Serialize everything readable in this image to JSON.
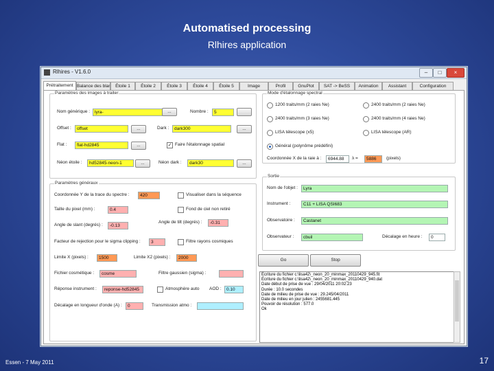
{
  "slide": {
    "title": "Automatised processing",
    "subtitle": "Rlhires application",
    "footer_left": "Essen - 7 May 2011",
    "page_number": "17"
  },
  "window": {
    "title": "Rlhires - V1.6.0",
    "min_label": "–",
    "max_label": "□",
    "close_label": "×"
  },
  "tabs": [
    "Prétraitement",
    "Balance des blancs",
    "Étoile 1",
    "Étoile 2",
    "Étoile 3",
    "Étoile 4",
    "Étoile 5",
    "Image",
    "Profil",
    "GnuPlot",
    "SAT -> BeSS",
    "Animation",
    "Assistant",
    "Configuration"
  ],
  "images": {
    "legend": "Paramètres des images à traiter",
    "generic_name_label": "Nom générique :",
    "generic_name_value": "lyra-",
    "number_label": "Nombre :",
    "number_value": "5",
    "offset_label": "Offset :",
    "offset_value": "offset",
    "dark_label": "Dark :",
    "dark_value": "dark300",
    "flat_label": "Flat :",
    "flat_value": "flat-hd2845",
    "spatial_flat_label": "Faire l'étalonnage spatial",
    "neon_star_label": "Néon étoile :",
    "neon_star_value": "hd52845-neon-1",
    "neon_dark_label": "Néon dark :",
    "neon_dark_value": "dark30",
    "browse_label": "..."
  },
  "general": {
    "legend": "Paramètres généraux",
    "y_coord_label": "Coordonnée Y de la trace du spectre :",
    "y_coord_value": "420",
    "check_seq_label": "Visualiser dans la séquence",
    "pixel_size_label": "Taille du pixel (mm) :",
    "pixel_size_value": "0.4",
    "sky_bg_label": "Fond de ciel non retiré",
    "slant_label": "Angle de slant (degrés) :",
    "slant_value": "-0.13",
    "tilt_label": "Angle de tilt (degrés) :",
    "tilt_value": "-0.31",
    "sigma_label": "Facteur de rejection pour le sigma clipping :",
    "sigma_value": "3",
    "cosmic_label": "Filtre rayons cosmiques",
    "limit_x_label": "Limite X (pixels) :",
    "limit_x_value": "1500",
    "limit_x2_label": "Limite X2 (pixels) :",
    "limit_x2_value": "2000",
    "cosmetic_label": "Fichier cosmétique :",
    "cosmetic_value": "cosme",
    "gauss_label": "Filtre gaussien (sigma) :",
    "gauss_value": "",
    "response_label": "Réponse instrument :",
    "response_value": "reponse-hd52845",
    "atmo_label": "Atmosphère auto",
    "aod_label": "AOD :",
    "aod_value": "0.10",
    "lambda_shift_label": "Décalage en longueur d'onde (A) :",
    "lambda_shift_value": "0",
    "atmo_trans_label": "Transmission atmo :",
    "atmo_trans_value": ""
  },
  "spectral": {
    "legend": "Mode d'étalonnage spectral",
    "opt1": "1200 traits/mm (2 raies Ne)",
    "opt2": "2400 traits/mm (2 raies Ne)",
    "opt3": "2400 traits/mm (3 raies Ne)",
    "opt4": "2400 traits/mm (4 raies Ne)",
    "opt5": "LISA télescope (x5)",
    "opt6": "LISA télescope (AR)",
    "opt7": "Général (polynôme prédéfini)",
    "coord_label": "Coordonnée X de la raie à :",
    "coord_value": "6944.88",
    "lambda_label": "λ =",
    "lambda_value": "5886",
    "pixels_label": "(pixels)"
  },
  "output": {
    "legend": "Sortie",
    "object_label": "Nom de l'objet :",
    "object_value": "Lyra",
    "instrument_label": "Instrument :",
    "instrument_value": "C11 + LISA QSI683",
    "observatory_label": "Observatoire :",
    "observatory_value": "Castanet",
    "observer_label": "Observateur :",
    "observer_value": "cbuil",
    "hour_shift_label": "Décalage en heure :",
    "hour_shift_value": "0"
  },
  "actions": {
    "go_label": "Go",
    "stop_label": "Stop"
  },
  "log": [
    "Écriture du fichier c:\\lisa42\\_neon_20_minmax_20110429_945.fit",
    "Écriture du fichier c:\\lisa42\\_neon_20_minmax_20110429_940.dat",
    "",
    "Date début de prise de vue : 29/04/2011 20:02:23",
    "Durée : 10.0 secondes",
    "Date de milieu de prise de vue : 29.245/04/2011",
    "Date de milieu en jour julien : 2455681.445",
    "Pouvoir de résolution : 577.0",
    "Ok"
  ],
  "colors": {
    "slide_bg": "#2f4c9e",
    "yellow_field": "#ffff33",
    "orange_field": "#ff9955",
    "pink_field": "#ffb0b0",
    "green_field": "#b4f5b4",
    "cyan_field": "#aeefff"
  }
}
